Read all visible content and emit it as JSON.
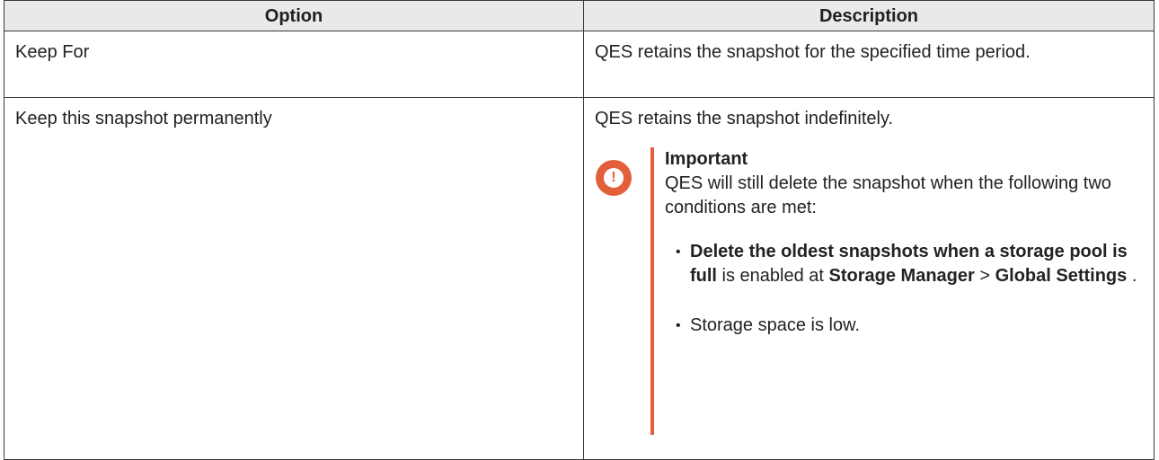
{
  "table": {
    "headers": {
      "option": "Option",
      "description": "Description"
    },
    "rows": [
      {
        "option": "Keep For",
        "description": "QES retains the snapshot for the specified time period."
      },
      {
        "option": "Keep this snapshot permanently",
        "description": "QES retains the snapshot indefinitely.",
        "callout": {
          "icon": "important-icon",
          "accent_color": "#e35f3a",
          "title": "Important",
          "body": "QES will still delete the snapshot when the following two conditions are met:",
          "bullets": [
            {
              "bold_lead": "Delete the oldest snapshots when a storage pool is full",
              "text_mid": " is enabled at ",
              "bold_path_1": "Storage Manager",
              "separator": " > ",
              "bold_path_2": "Global Settings",
              "text_end": " ."
            },
            {
              "text": "Storage space is low."
            }
          ]
        }
      }
    ]
  }
}
